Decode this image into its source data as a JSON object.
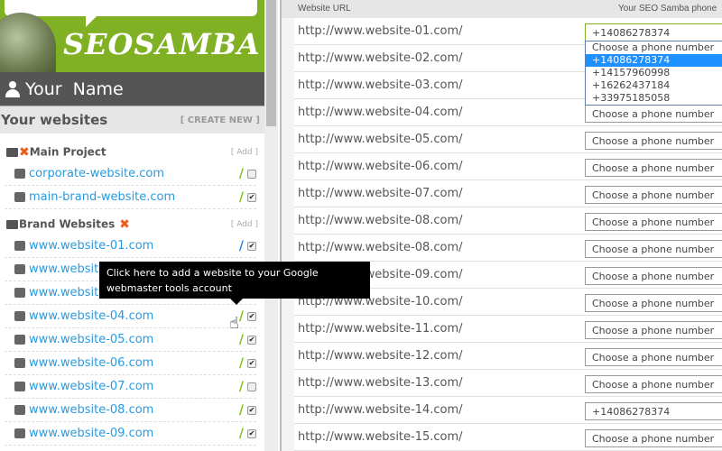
{
  "brand": {
    "logo_text": "SEOSAMBA"
  },
  "user": {
    "name": "Your  Name"
  },
  "sidebar": {
    "title": "Your websites",
    "create_new": "[ CREATE NEW ]",
    "groups": [
      {
        "name": "Main Project",
        "add": "[ Add ]",
        "items": [
          {
            "label": "corporate-website.com",
            "wrench": "green",
            "checked": false
          },
          {
            "label": "main-brand-website.com",
            "wrench": "green",
            "checked": true
          }
        ]
      },
      {
        "name": "Brand Websites",
        "add": "[ Add ]",
        "items": [
          {
            "label": "www.website-01.com",
            "wrench": "blue",
            "checked": true
          },
          {
            "label": "www.website-02.com",
            "wrench": "green",
            "checked": true
          },
          {
            "label": "www.website-03.com",
            "wrench": "green",
            "checked": true
          },
          {
            "label": "www.website-04.com",
            "wrench": "green",
            "checked": true
          },
          {
            "label": "www.website-05.com",
            "wrench": "green",
            "checked": true
          },
          {
            "label": "www.website-06.com",
            "wrench": "green",
            "checked": true
          },
          {
            "label": "www.website-07.com",
            "wrench": "green",
            "checked": false
          },
          {
            "label": "www.website-08.com",
            "wrench": "green",
            "checked": true
          },
          {
            "label": "www.website-09.com",
            "wrench": "green",
            "checked": true
          }
        ]
      }
    ]
  },
  "tooltip": "Click here to add a website to your Google webmaster tools account",
  "table": {
    "headers": [
      "Website URL",
      "Your SEO Samba phone"
    ],
    "rows": [
      {
        "url": "http://www.website-01.com/",
        "phone": "+14086278374"
      },
      {
        "url": "http://www.website-02.com/",
        "phone": "Choose a phone number"
      },
      {
        "url": "http://www.website-03.com/",
        "phone": "Choose a phone number"
      },
      {
        "url": "http://www.website-04.com/",
        "phone": "Choose a phone number"
      },
      {
        "url": "http://www.website-05.com/",
        "phone": "Choose a phone number"
      },
      {
        "url": "http://www.website-06.com/",
        "phone": "Choose a phone number"
      },
      {
        "url": "http://www.website-07.com/",
        "phone": "Choose a phone number"
      },
      {
        "url": "http://www.website-08.com/",
        "phone": "Choose a phone number"
      },
      {
        "url": "http://www.website-08.com/",
        "phone": "Choose a phone number"
      },
      {
        "url": "http://www.website-09.com/",
        "phone": "Choose a phone number"
      },
      {
        "url": "http://www.website-10.com/",
        "phone": "Choose a phone number"
      },
      {
        "url": "http://www.website-11.com/",
        "phone": "Choose a phone number"
      },
      {
        "url": "http://www.website-12.com/",
        "phone": "Choose a phone number"
      },
      {
        "url": "http://www.website-13.com/",
        "phone": "Choose a phone number"
      },
      {
        "url": "http://www.website-14.com/",
        "phone": "+14086278374"
      },
      {
        "url": "http://www.website-15.com/",
        "phone": "Choose a phone number"
      }
    ],
    "dropdown_options": [
      "Choose a phone number",
      "+14086278374",
      "+14157960998",
      "+16262437184",
      "+33975185058"
    ],
    "dropdown_selected": "+14086278374"
  },
  "colors": {
    "brand_green": "#80b024",
    "link": "#2a9ae0",
    "highlight": "#1e90ff"
  }
}
